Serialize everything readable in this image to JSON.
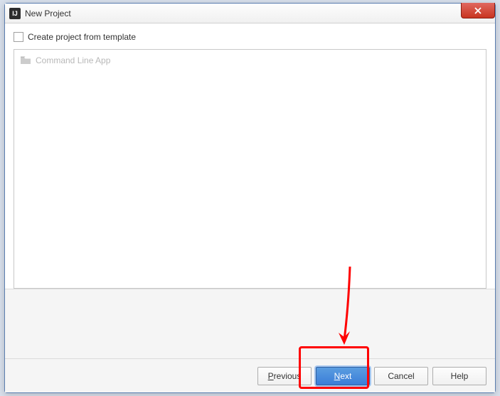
{
  "window": {
    "title": "New Project",
    "icon_letters": "IJ"
  },
  "checkbox": {
    "label": "Create project from template"
  },
  "templates": {
    "items": [
      {
        "label": "Command Line App"
      }
    ]
  },
  "buttons": {
    "previous": "Previous",
    "next": "Next",
    "cancel": "Cancel",
    "help": "Help"
  }
}
